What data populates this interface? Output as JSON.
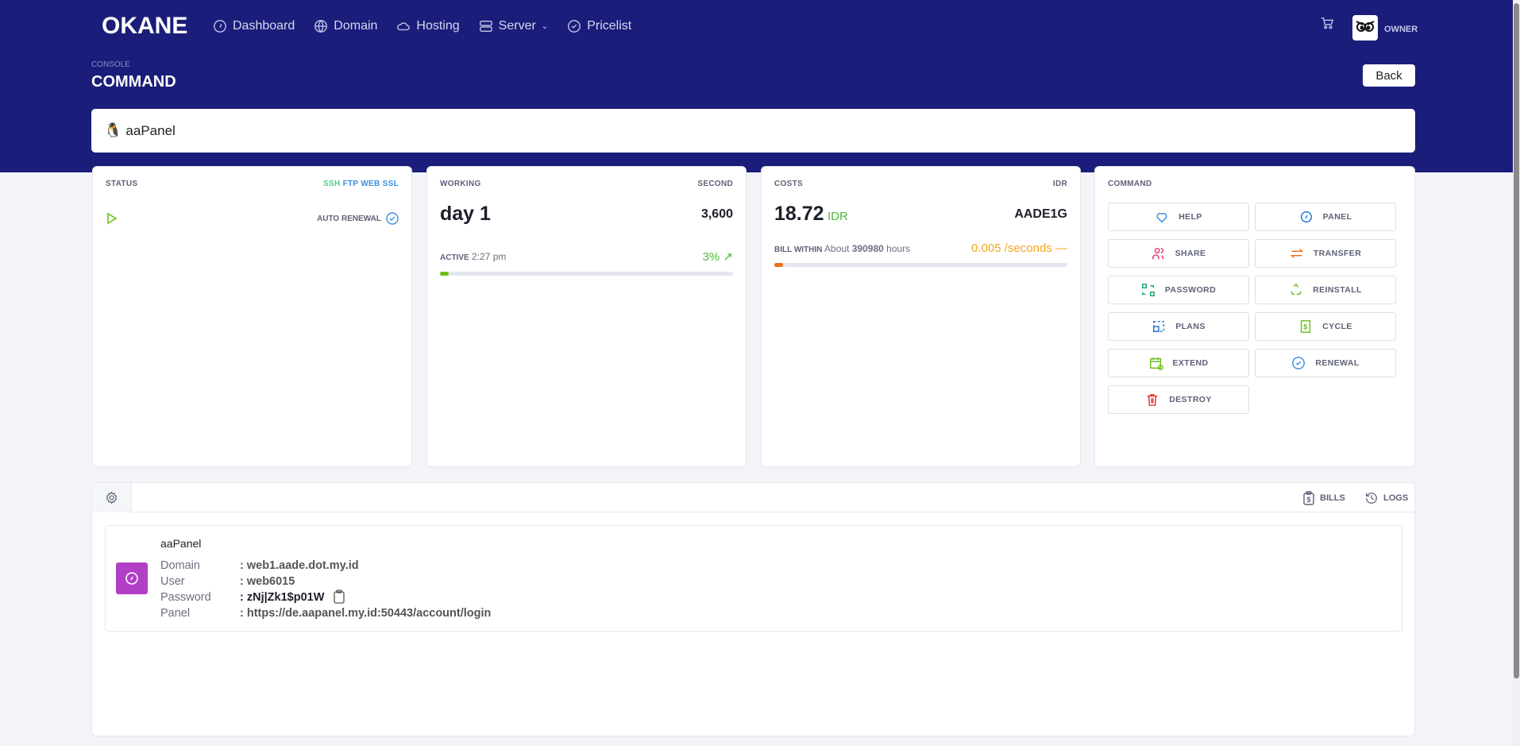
{
  "nav": {
    "logo": "OKANE",
    "items": [
      {
        "label": "Dashboard",
        "icon": "gauge-icon"
      },
      {
        "label": "Domain",
        "icon": "www-icon"
      },
      {
        "label": "Hosting",
        "icon": "cloud-icon"
      },
      {
        "label": "Server",
        "icon": "server-icon"
      },
      {
        "label": "Pricelist",
        "icon": "badge-check-icon"
      }
    ],
    "user": "OWNER"
  },
  "page": {
    "breadcrumb": "CONSOLE",
    "title": "COMMAND",
    "back": "Back",
    "server_name": "aaPanel"
  },
  "status": {
    "title": "STATUS",
    "tags": [
      {
        "label": "SSH",
        "color": "#50cd89"
      },
      {
        "label": "FTP",
        "color": "#3b8fe0"
      },
      {
        "label": "WEB",
        "color": "#3b8fe0"
      },
      {
        "label": "SSL",
        "color": "#3b8fe0"
      }
    ],
    "auto_renewal": "AUTO RENEWAL"
  },
  "working": {
    "title": "WORKING",
    "unit": "SECOND",
    "value": "day 1",
    "seconds": "3,600",
    "active_label": "ACTIVE",
    "active_time": "2:27 pm",
    "percent": "3%",
    "progress": 3
  },
  "costs": {
    "title": "COSTS",
    "currency": "IDR",
    "amount": "18.72",
    "amount_currency": "IDR",
    "code": "AADE1G",
    "bill_label": "BILL WITHIN",
    "bill_about": "About",
    "bill_hours": "390980",
    "bill_unit": "hours",
    "rate": "0.005 /seconds",
    "progress": 3
  },
  "command": {
    "title": "COMMAND",
    "buttons": [
      {
        "label": "HELP",
        "color": "#3b8fe0"
      },
      {
        "label": "PANEL",
        "color": "#1e6fd9"
      },
      {
        "label": "SHARE",
        "color": "#e0336b"
      },
      {
        "label": "TRANSFER",
        "color": "#f06a16"
      },
      {
        "label": "PASSWORD",
        "color": "#1aa56a"
      },
      {
        "label": "REINSTALL",
        "color": "#6bbf1e"
      },
      {
        "label": "PLANS",
        "color": "#1e6fd9"
      },
      {
        "label": "CYCLE",
        "color": "#6bbf1e"
      },
      {
        "label": "EXTEND",
        "color": "#6bbf1e"
      },
      {
        "label": "RENEWAL",
        "color": "#3b8fe0"
      },
      {
        "label": "DESTROY",
        "color": "#e03333"
      }
    ]
  },
  "details": {
    "tabs": {
      "bills": "BILLS",
      "logs": "LOGS"
    },
    "name": "aaPanel",
    "fields": [
      {
        "key": "Domain",
        "value": ": web1.aade.dot.my.id"
      },
      {
        "key": "User",
        "value": ": web6015"
      },
      {
        "key": "Password",
        "value": ": zNj|Zk1$p01W"
      },
      {
        "key": "Panel",
        "value": ": https://de.aapanel.my.id:50443/account/login"
      }
    ]
  }
}
